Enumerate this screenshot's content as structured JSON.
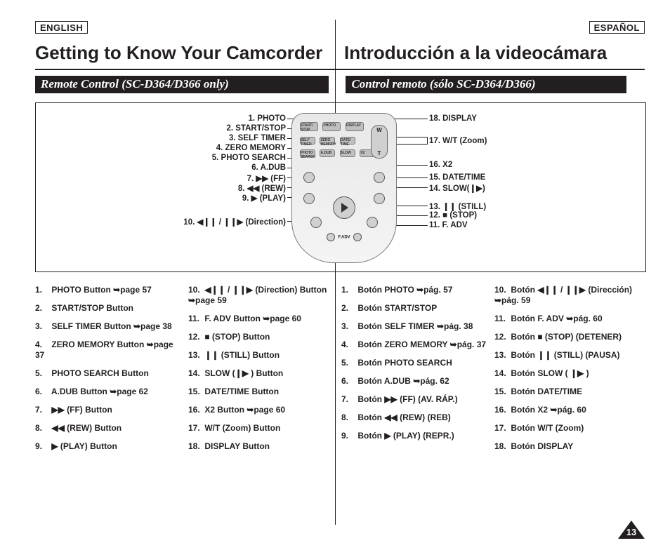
{
  "lang": {
    "en": "ENGLISH",
    "es": "ESPAÑOL"
  },
  "head": {
    "en": "Getting to Know Your Camcorder",
    "es": "Introducción a la videocámara"
  },
  "sub": {
    "en": "Remote Control (SC-D364/D366 only)",
    "es": "Control remoto (sólo SC-D364/D366)"
  },
  "page_number": "13",
  "diagram": {
    "left": {
      "l1": "1. PHOTO",
      "l2": "2. START/STOP",
      "l3": "3. SELF TIMER",
      "l4": "4. ZERO MEMORY",
      "l5": "5. PHOTO SEARCH",
      "l6": "6. A.DUB",
      "l7_pre": "7. ",
      "l7_post": "(FF)",
      "l8_pre": "8. ",
      "l8_post": "(REW)",
      "l9_pre": "9. ",
      "l9_post": "(PLAY)",
      "l10_pre": "10. ",
      "l10_post": "(Direction)"
    },
    "right": {
      "r18": "18. DISPLAY",
      "r17": "17.  W/T (Zoom)",
      "r16": "16. X2",
      "r15": "15. DATE/TIME",
      "r14_pre": "14. SLOW(",
      "r14_post": ")",
      "r13_pre": "13. ",
      "r13_post": "(STILL)",
      "r12_pre": "12. ",
      "r12_post": "(STOP)",
      "r11": "11. F. ADV"
    },
    "wt": {
      "w": "W",
      "t": "T"
    }
  },
  "list_en_a": [
    {
      "t": "PHOTO Button ➥page 57"
    },
    {
      "t": "START/STOP Button"
    },
    {
      "t": "SELF TIMER Button ➥page 38"
    },
    {
      "t": "ZERO MEMORY Button ➥page 37"
    },
    {
      "t": "PHOTO SEARCH Button"
    },
    {
      "t": "A.DUB Button ➥page 62"
    },
    {
      "t": "▶▶ (FF) Button",
      "sym": true
    },
    {
      "t": "◀◀ (REW) Button",
      "sym": true
    },
    {
      "t": "▶ (PLAY) Button",
      "sym": true
    }
  ],
  "list_en_b": [
    {
      "n": "10.",
      "t": "◀❙❙ / ❙❙▶ (Direction) Button ➥page 59",
      "sym": true
    },
    {
      "n": "11.",
      "t": "F. ADV Button ➥page 60"
    },
    {
      "n": "12.",
      "t": "■ (STOP) Button",
      "sym": true
    },
    {
      "n": "13.",
      "t": "❙❙ (STILL) Button",
      "sym": true
    },
    {
      "n": "14.",
      "t": "SLOW (❙▶ ) Button",
      "sym": true
    },
    {
      "n": "15.",
      "t": "DATE/TIME Button"
    },
    {
      "n": "16.",
      "t": "X2 Button ➥page 60"
    },
    {
      "n": "17.",
      "t": "W/T (Zoom) Button"
    },
    {
      "n": "18.",
      "t": "DISPLAY Button"
    }
  ],
  "list_es_a": [
    {
      "t": "Botón PHOTO ➥pág. 57"
    },
    {
      "t": "Botón START/STOP"
    },
    {
      "t": "Botón SELF TIMER ➥pág. 38"
    },
    {
      "t": "Botón ZERO MEMORY ➥pág. 37"
    },
    {
      "t": "Botón PHOTO SEARCH"
    },
    {
      "t": "Botón A.DUB ➥pág. 62"
    },
    {
      "t": "Botón ▶▶ (FF) (AV. RÁP.)",
      "sym": true
    },
    {
      "t": "Botón ◀◀ (REW) (REB)",
      "sym": true
    },
    {
      "t": "Botón ▶ (PLAY) (REPR.)",
      "sym": true
    }
  ],
  "list_es_b": [
    {
      "n": "10.",
      "t": "Botón ◀❙❙ / ❙❙▶  (Dirección) ➥pág. 59",
      "sym": true
    },
    {
      "n": "11.",
      "t": "Botón F. ADV ➥pág. 60"
    },
    {
      "n": "12.",
      "t": "Botón ■ (STOP) (DETENER)",
      "sym": true
    },
    {
      "n": "13.",
      "t": "Botón ❙❙ (STILL) (PAUSA)",
      "sym": true
    },
    {
      "n": "14.",
      "t": "Botón SLOW ( ❙▶ )",
      "sym": true
    },
    {
      "n": "15.",
      "t": "Botón DATE/TIME"
    },
    {
      "n": "16.",
      "t": "Botón X2 ➥pág. 60"
    },
    {
      "n": "17.",
      "t": "Botón W/T (Zoom)"
    },
    {
      "n": "18.",
      "t": "Botón DISPLAY"
    }
  ]
}
